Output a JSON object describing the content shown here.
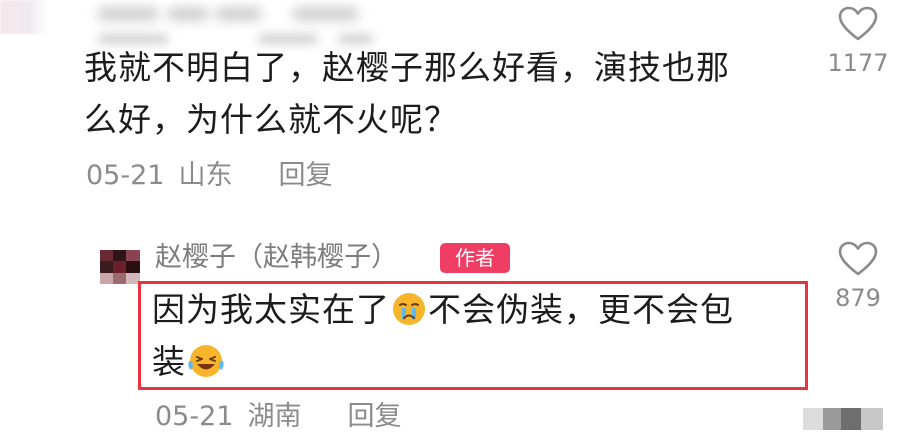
{
  "comments": [
    {
      "text_lines": [
        "我就不明白了，赵樱子那么好看，演技也那",
        "么好，为什么就不火呢？"
      ],
      "date": "05-21",
      "location": "山东",
      "reply_label": "回复",
      "like_count": "1177"
    },
    {
      "username": "赵樱子（赵韩樱子）",
      "badge": "作者",
      "text_line1_a": "因为我太实在了",
      "text_line1_b": "不会伪装，更不会包",
      "text_line2": "装",
      "emoji_1": "sad-crying-emoji",
      "emoji_2": "laugh-crying-emoji",
      "date": "05-21",
      "location": "湖南",
      "reply_label": "回复",
      "like_count": "879"
    }
  ],
  "colors": {
    "text": "#1c1c1c",
    "meta": "#8b8b8b",
    "badge_bg": "#ef3d64",
    "highlight_border": "#e8353d"
  },
  "icons": [
    "heart-outline-icon"
  ]
}
